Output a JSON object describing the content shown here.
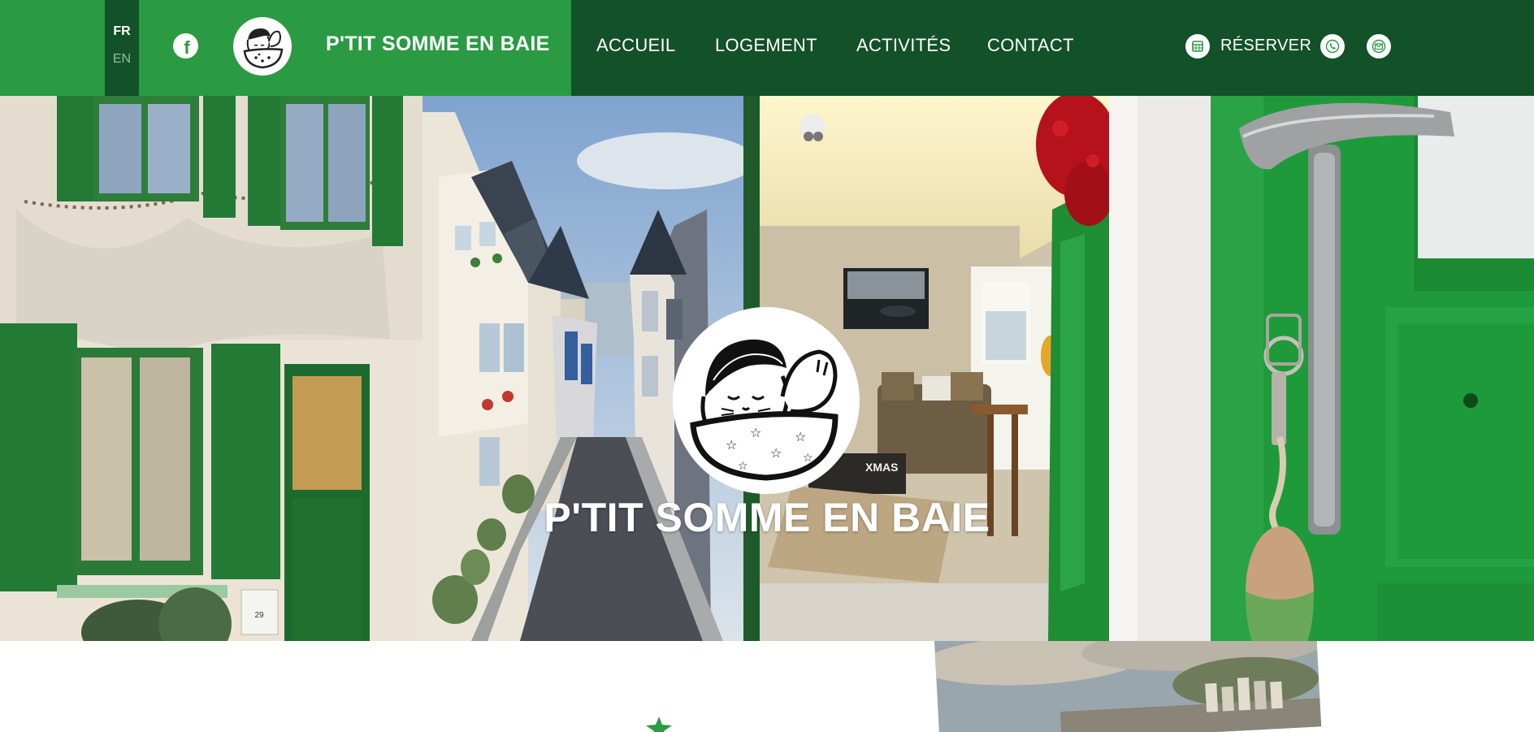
{
  "header": {
    "languages": {
      "fr": "FR",
      "en": "EN"
    },
    "brand": "P'TIT SOMME EN BAIE",
    "nav": [
      "ACCUEIL",
      "LOGEMENT",
      "ACTIVITÉS",
      "CONTACT"
    ],
    "reserve_label": "RÉSERVER",
    "icons": [
      "facebook-icon",
      "logo-seal-icon",
      "calendar-icon",
      "phone-icon",
      "mail-icon"
    ]
  },
  "hero": {
    "title": "P'TIT SOMME EN BAIE",
    "sign_text": "XMAS",
    "house_number": "29"
  },
  "colors": {
    "header_dark": "#135128",
    "header_light": "#2a9a43",
    "white": "#ffffff"
  }
}
